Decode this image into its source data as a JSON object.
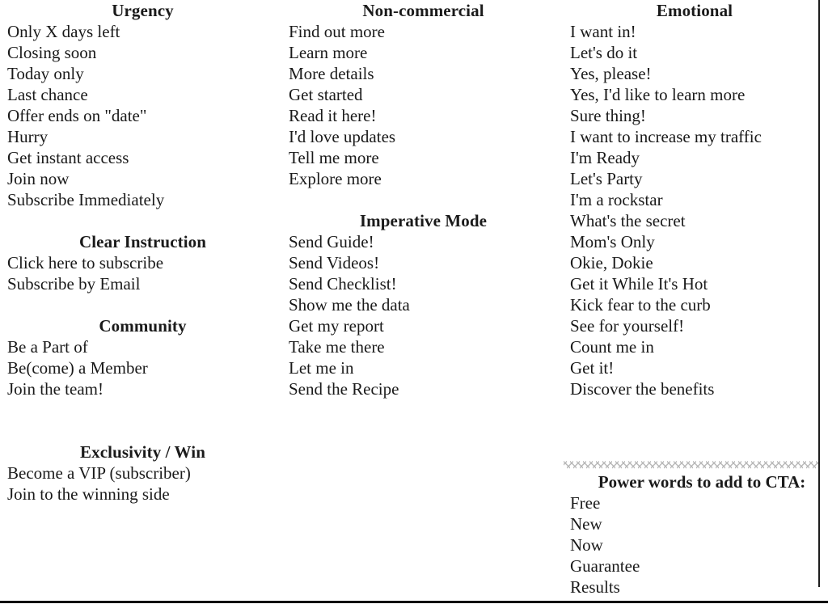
{
  "document": {
    "kind": "cta-phrase-reference-sheet",
    "colors": {
      "text": "#1a1a1a",
      "rule": "#000000",
      "zigzag": "#b9b9b9",
      "background": "#ffffff"
    }
  },
  "columns": [
    {
      "id": "column-left",
      "sections": [
        {
          "id": "urgency",
          "title": "Urgency",
          "items": [
            "Only X days left",
            "Closing soon",
            "Today only",
            "Last chance",
            "Offer ends on \"date\"",
            "Hurry",
            "Get instant access",
            "Join now",
            "Subscribe Immediately"
          ]
        },
        {
          "id": "clear-instruction",
          "title": "Clear Instruction",
          "items": [
            "Click here to subscribe",
            "Subscribe by Email"
          ]
        },
        {
          "id": "community",
          "title": "Community",
          "items": [
            "Be a Part of",
            "Be(come) a Member",
            "Join the team!"
          ]
        },
        {
          "id": "exclusivity-win",
          "title": "Exclusivity / Win",
          "items": [
            "Become a VIP (subscriber)",
            "Join to the winning side"
          ]
        }
      ]
    },
    {
      "id": "column-middle",
      "sections": [
        {
          "id": "non-commercial",
          "title": "Non-commercial",
          "items": [
            "Find out more",
            "Learn more",
            "More details",
            "Get started",
            "Read it here!",
            "I'd love updates",
            "Tell me more",
            "Explore more"
          ]
        },
        {
          "id": "imperative-mode",
          "title": "Imperative Mode",
          "items": [
            "Send Guide!",
            "Send Videos!",
            "Send Checklist!",
            "Show me the data",
            "Get my report",
            "Take me there",
            "Let me in",
            "Send the Recipe"
          ]
        }
      ]
    },
    {
      "id": "column-right",
      "sections": [
        {
          "id": "emotional",
          "title": "Emotional",
          "items": [
            "I want in!",
            "Let's do it",
            "Yes, please!",
            "Yes, I'd like to learn more",
            "Sure thing!",
            "I want to increase my traffic",
            "I'm Ready",
            "Let's Party",
            "I'm a rockstar",
            "What's the secret",
            "Mom's Only",
            "Okie, Dokie",
            "Get it While It's Hot",
            "Kick fear to the curb",
            "See for yourself!",
            "Count me in",
            "Get it!",
            "Discover the benefits"
          ]
        }
      ]
    }
  ],
  "power_words": {
    "title": "Power words to add to CTA:",
    "items": [
      "Free",
      "New",
      "Now",
      "Guarantee",
      "Results"
    ]
  }
}
